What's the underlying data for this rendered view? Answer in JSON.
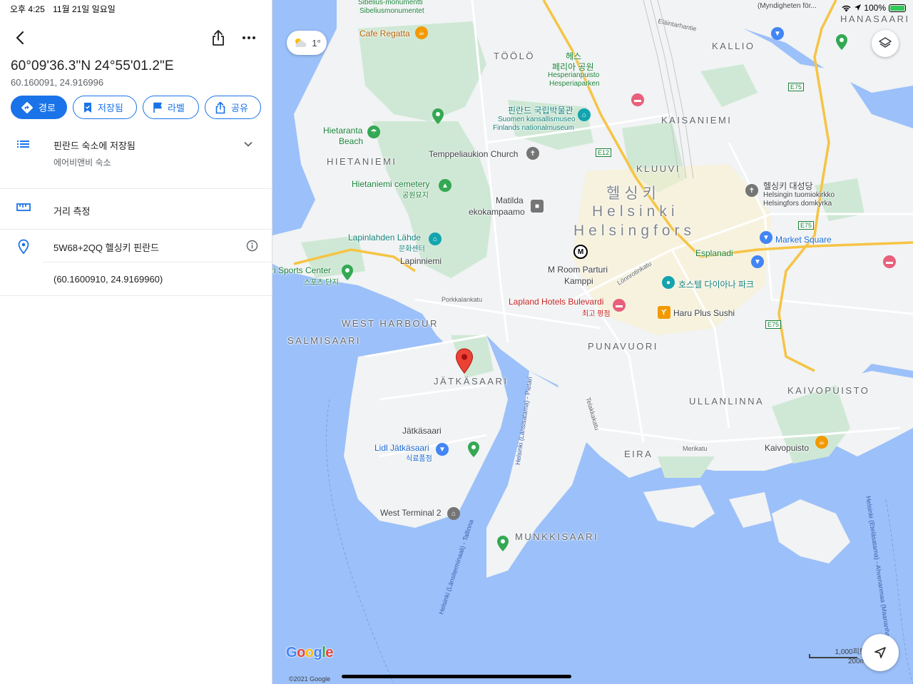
{
  "status_bar": {
    "time": "오후 4:25",
    "date": "11월 21일 일요일",
    "battery": "100%"
  },
  "place": {
    "title": "60°09'36.3\"N 24°55'01.2\"E",
    "subtitle": "60.160091, 24.916996"
  },
  "actions": [
    {
      "label": "경로",
      "icon": "directions-icon"
    },
    {
      "label": "저장됨",
      "icon": "bookmark-icon"
    },
    {
      "label": "라벨",
      "icon": "flag-icon"
    },
    {
      "label": "공유",
      "icon": "share-icon"
    }
  ],
  "saved_list": {
    "title": "핀란드 숙소에 저장됨",
    "subtitle": "에어비앤비 숙소",
    "icon": "list-icon"
  },
  "measure": {
    "label": "거리 측정",
    "icon": "ruler-icon"
  },
  "plus_code": {
    "label": "5W68+2QQ 헬싱키 핀란드",
    "coords": "(60.1600910, 24.9169960)",
    "icon": "location-pin-icon"
  },
  "map": {
    "weather": "1°",
    "google": "Google",
    "copyright": "©2021 Google",
    "scale_ft": "1,000피트",
    "scale_m": "200m",
    "labels": {
      "sibelius": "Sibelius-monumentti",
      "sibelius2": "Sibeliusmonumentet",
      "cafe_regatta": "Cafe Regatta",
      "toolo": "TÖÖLÖ",
      "hesperia_kr1": "헤스",
      "hesperia_kr2": "페리아 공원",
      "hesperia_fi": "Hesperianpuisto",
      "hesperia_sv": "Hesperiaparken",
      "kallio": "KALLIO",
      "hanasaari": "HANASAARI",
      "museum_kr": "핀란드 국립박물관",
      "museum_fi": "Suomen kansallismuseo",
      "museum_sv": "Finlands nationalmuseum",
      "kaisaniemi": "KAISANIEMI",
      "hietaranta1": "Hietaranta",
      "hietaranta2": "Beach",
      "temppeli": "Temppeliaukion Church",
      "hietaniemi": "HIETANIEMI",
      "kluuvi": "KLUUVI",
      "cemetery": "Hietaniemi cemetery",
      "cemetery_kr": "공원묘지",
      "city_kr": "헬싱키",
      "city_fi": "Helsinki",
      "city_sv": "Helsingfors",
      "cathedral_kr": "헬싱키 대성당",
      "cathedral_fi": "Helsingin tuomiokirkko",
      "cathedral_sv": "Helsingfors domkyrka",
      "matilda1": "Matilda",
      "matilda2": "ekokampaamo",
      "lapinlahti": "Lapinlahden Lähde",
      "lapinlahti_kr": "문화센터",
      "lapinniemi": "Lapinniemi",
      "market": "Market Square",
      "esplanadi": "Esplanadi",
      "sports": "ri Sports Center",
      "sports_kr": "스포츠 단지",
      "mroom1": "M Room Parturi",
      "mroom2": "Kamppi",
      "lonnrotinkatu": "Lönnrotinkatu",
      "hostel": "호스텔 다이아나 파크",
      "porkkala": "Porkkalankatu",
      "lapland": "Lapland Hotels Bulevardi",
      "lapland_kr": "최고 평점",
      "haru": "Haru Plus Sushi",
      "west_harbour": "WEST HARBOUR",
      "salmisaari": "SALMISAARI",
      "punavuori": "PUNAVUORI",
      "jatkasaari": "JÄTKÄSAARI",
      "kaivopuisto_d": "KAIVOPUISTO",
      "ullanlinna": "ULLANLINNA",
      "jatkasaari2": "Jätkäsaari",
      "lidl": "Lidl Jätkäsaari",
      "lidl_kr": "식료품점",
      "eira": "EIRA",
      "merikatu": "Merikatu",
      "kaivopuisto": "Kaivopuisto",
      "west_terminal": "West Terminal 2",
      "munkkisaari": "MUNKKISAARI",
      "route_pietari": "Helsinki (Länsisatama) - Pietari",
      "route_tallinna": "Helsinki (Länsiterminaali) - Tallinna",
      "route_east": "Helsinki (Eteläsatama) - Ahvenanmaa (Maarianhamina)",
      "tehtaankatu": "Telakkakatu",
      "myndigheter": "(Myndigheten för...",
      "elaintarhantie": "Eläintarhantie",
      "e12": "E12",
      "e75": "E75"
    }
  }
}
